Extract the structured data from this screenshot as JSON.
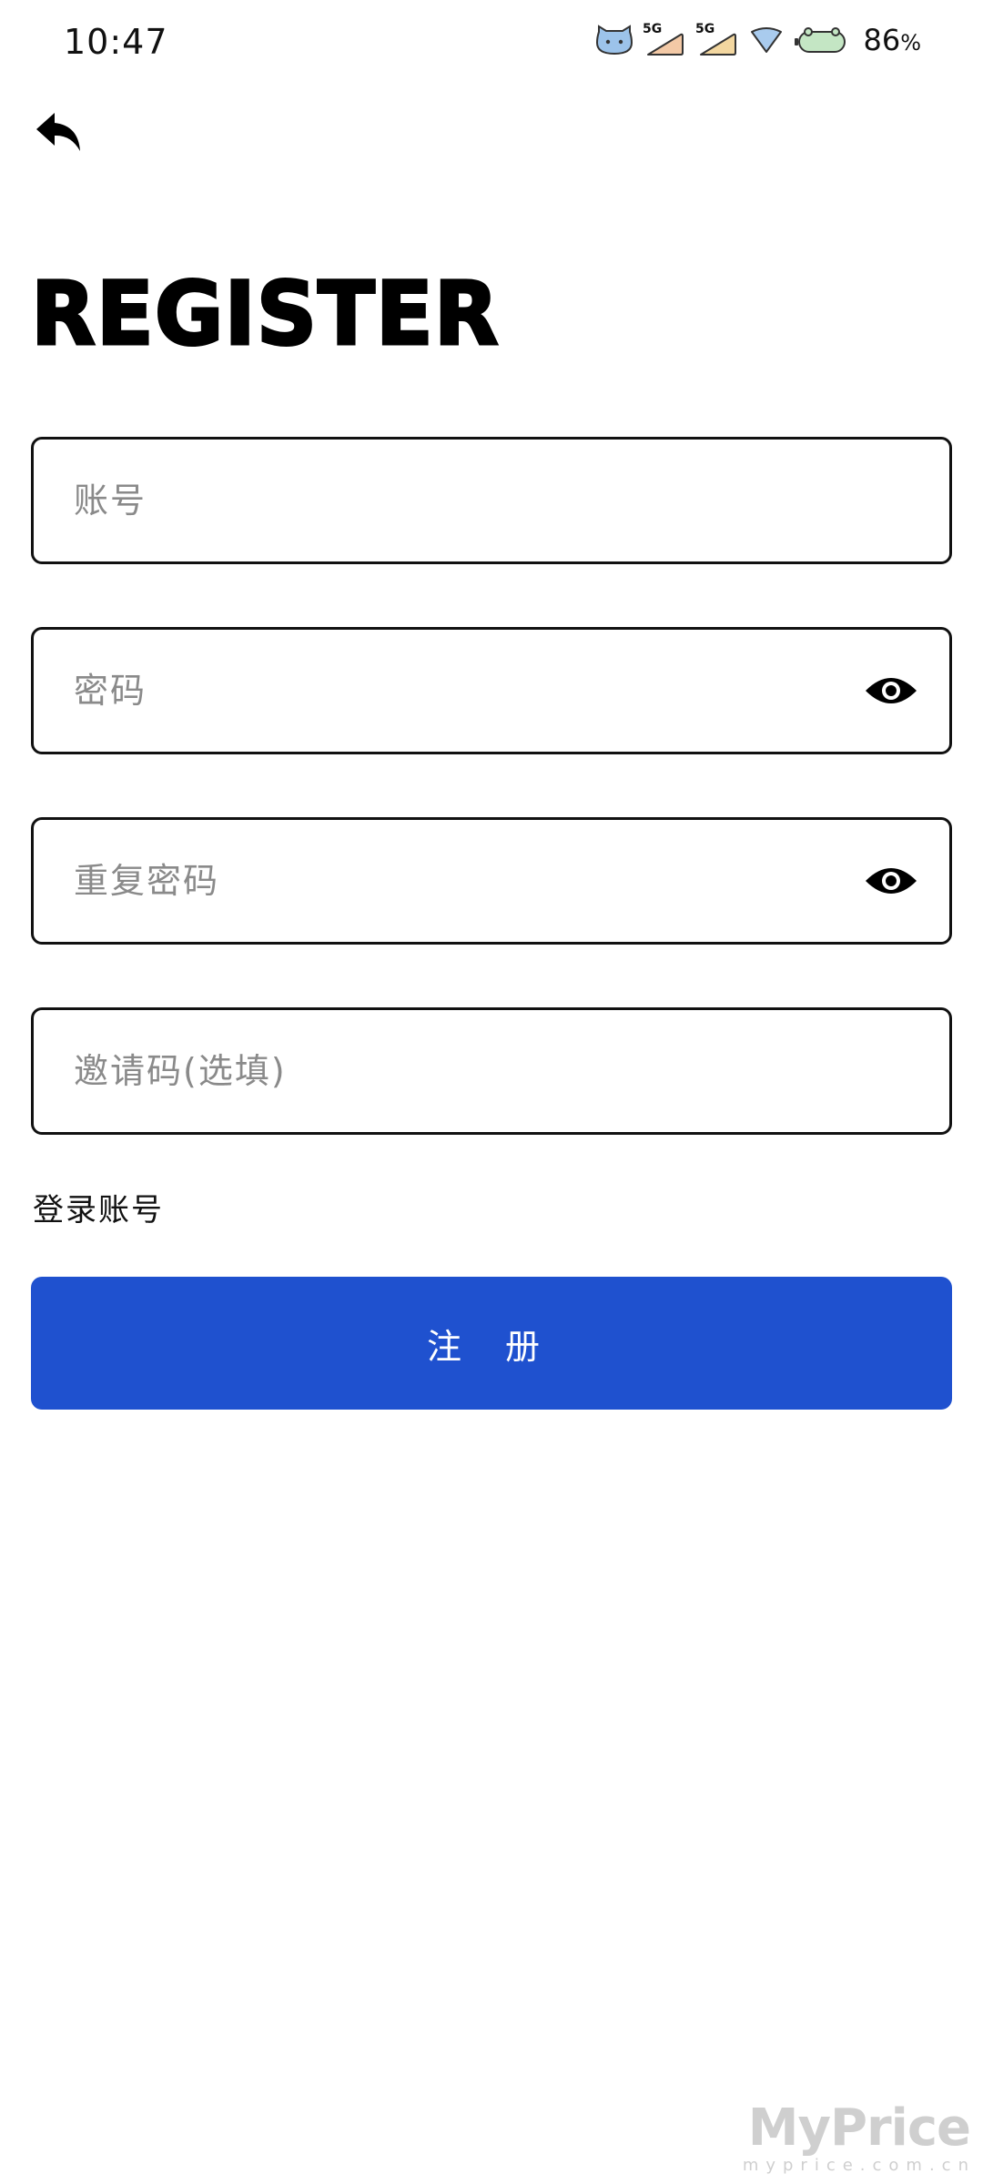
{
  "status_bar": {
    "time": "10:47",
    "network_1": "5G",
    "network_2": "5G",
    "battery_level": "86",
    "battery_unit": "%"
  },
  "header": {
    "title": "REGISTER"
  },
  "form": {
    "account_placeholder": "账号",
    "password_placeholder": "密码",
    "repeat_password_placeholder": "重复密码",
    "invite_code_placeholder": "邀请码(选填)",
    "login_link": "登录账号",
    "register_button": "注 册"
  },
  "watermark": {
    "main": "MyPrice",
    "sub": "myprice.com.cn"
  },
  "colors": {
    "primary": "#1f51cf",
    "border": "#111111",
    "placeholder": "#8a8a8a"
  }
}
